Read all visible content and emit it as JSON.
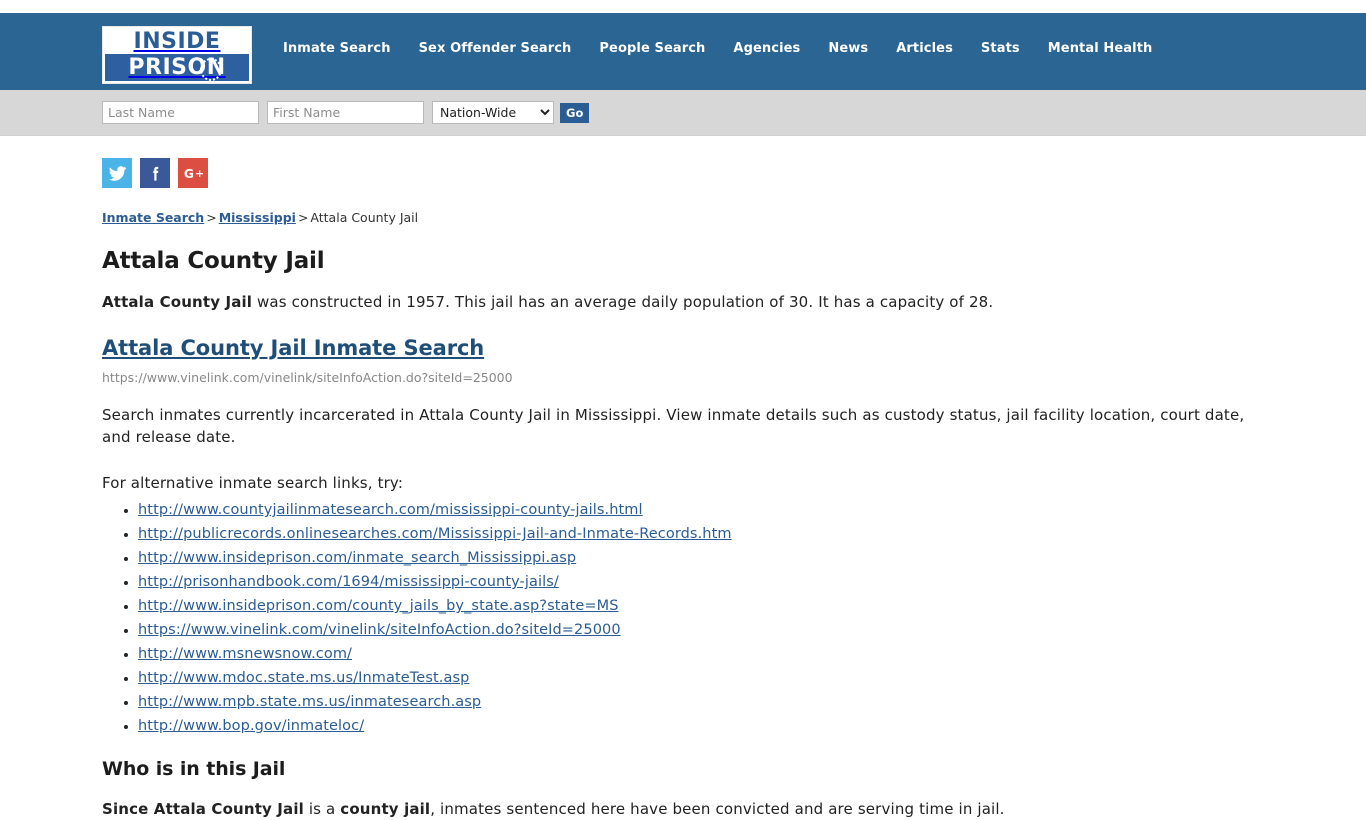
{
  "header": {
    "logo": {
      "line1": "INSIDE",
      "line2": "PRISON"
    },
    "nav": [
      {
        "label": "Inmate Search"
      },
      {
        "label": "Sex Offender Search"
      },
      {
        "label": "People Search"
      },
      {
        "label": "Agencies"
      },
      {
        "label": "News"
      },
      {
        "label": "Articles"
      },
      {
        "label": "Stats"
      },
      {
        "label": "Mental Health"
      }
    ],
    "background_color": "#2a6593"
  },
  "search_bar": {
    "last_name_placeholder": "Last Name",
    "last_name_value": "",
    "first_name_placeholder": "First Name",
    "first_name_value": "",
    "scope_selected": "Nation-Wide",
    "scope_options": [
      "Nation-Wide"
    ],
    "go_label": "Go",
    "background_color": "#d7d7d7",
    "go_color": "#2a5d94"
  },
  "social": [
    {
      "name": "twitter",
      "label": "Twitter",
      "color": "#4ab3e8"
    },
    {
      "name": "facebook",
      "label": "Facebook",
      "color": "#3b5998"
    },
    {
      "name": "googleplus",
      "label": "Google Plus",
      "color": "#dc4e41"
    }
  ],
  "breadcrumb": {
    "item1": "Inmate Search",
    "sep1": ">",
    "item2": "Mississippi",
    "sep2": ">",
    "current": "Attala County Jail"
  },
  "main": {
    "page_title": "Attala County Jail",
    "intro_bold": "Attala County Jail",
    "intro_rest": " was constructed in 1957. This jail has an average daily population of 30. It has a capacity of 28.",
    "inmate_search_link_label": "Attala County Jail Inmate Search",
    "inmate_search_url": "https://www.vinelink.com/vinelink/siteInfoAction.do?siteId=25000",
    "description": "Search inmates currently incarcerated in Attala County Jail in Mississippi. View inmate details such as custody status, jail facility location, court date, and release date.",
    "alt_links_intro": "For alternative inmate search links, try:",
    "alt_links": [
      "http://www.countyjailinmatesearch.com/mississippi-county-jails.html",
      "http://publicrecords.onlinesearches.com/Mississippi-Jail-and-Inmate-Records.htm",
      "http://www.insideprison.com/inmate_search_Mississippi.asp",
      "http://prisonhandbook.com/1694/mississippi-county-jails/",
      "http://www.insideprison.com/county_jails_by_state.asp?state=MS",
      "https://www.vinelink.com/vinelink/siteInfoAction.do?siteId=25000",
      "http://www.msnewsnow.com/",
      "http://www.mdoc.state.ms.us/InmateTest.asp",
      "http://www.mpb.state.ms.us/inmatesearch.asp",
      "http://www.bop.gov/inmateloc/"
    ],
    "who_section_title": "Who is in this Jail",
    "who_bold_1": "Since Attala County Jail",
    "who_text_mid": " is a ",
    "who_bold_2": "county jail",
    "who_text_end": ", inmates sentenced here have been convicted and are serving time in jail."
  }
}
